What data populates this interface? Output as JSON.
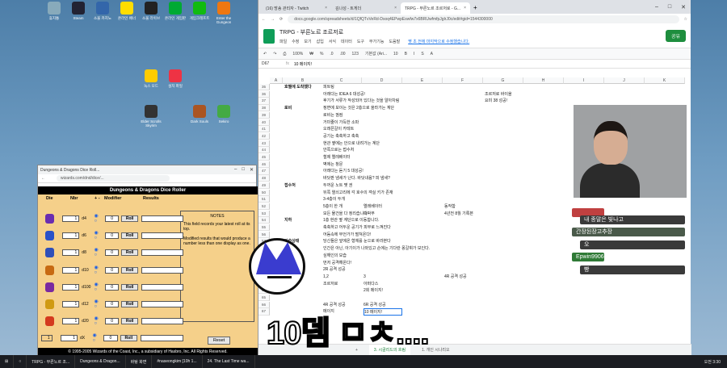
{
  "desktop": {
    "icons": [
      {
        "label": "휴지통"
      },
      {
        "label": "Steam"
      },
      {
        "label": "소울 카지노"
      },
      {
        "label": "온라인 배너"
      },
      {
        "label": "소울 라이브"
      },
      {
        "label": "온라인 게임판"
      },
      {
        "label": "게임크래프트"
      },
      {
        "label": "Enter the Gungeon"
      },
      {
        "label": "녹스 모드"
      },
      {
        "label": "설치 파일"
      },
      {
        "label": "Elder Scrolls Skyrim"
      },
      {
        "label": "Dark Souls"
      },
      {
        "label": "Sekiro"
      }
    ]
  },
  "dice": {
    "win_title": "Dungeons & Dragons Dice Roll...",
    "url": "wizards.com/dnd/dice/...",
    "header": "Dungeons & Dragons Dice Roller",
    "cols": {
      "die": "Die",
      "nbr": "Nbr",
      "pm": "+ -",
      "mod": "Modifier",
      "res": "Results"
    },
    "rows": [
      {
        "nbr": "1",
        "die": "d4",
        "mod": "0",
        "roll": "Roll"
      },
      {
        "nbr": "1",
        "die": "d6",
        "mod": "0",
        "roll": "Roll"
      },
      {
        "nbr": "1",
        "die": "d8",
        "mod": "0",
        "roll": "Roll"
      },
      {
        "nbr": "1",
        "die": "d10",
        "mod": "0",
        "roll": "Roll"
      },
      {
        "nbr": "1",
        "die": "d100",
        "mod": "0",
        "roll": "Roll"
      },
      {
        "nbr": "1",
        "die": "d12",
        "mod": "0",
        "roll": "Roll"
      },
      {
        "nbr": "1",
        "die": "d20",
        "mod": "0",
        "roll": "Roll"
      },
      {
        "nbr": "1",
        "die": "dX",
        "mod": "0",
        "roll": "Roll",
        "x": "1"
      }
    ],
    "notes_title": "NOTES",
    "notes_p1": "This field records your latest roll at its top.",
    "notes_p2": "Modified results that would produce a number less than one display as one.",
    "reset": "Reset",
    "copyright": "© 1995-2005 Wizards of the Coast, Inc., a subsidiary of Hasbro, Inc. All Rights Reserved."
  },
  "browser": {
    "tabs": [
      {
        "label": "(16) 방송 관리자 - Twitch"
      },
      {
        "label": "김나성 - 트게더"
      },
      {
        "label": "TRPG - 부른노르 조르저로 - G..."
      }
    ],
    "url": "docs.google.com/spreadsheets/d/1QfQTvVeRd-Dsoq4EPwpEswfw7x6BRUwfmfpJglrJ0c/edit#gid=1544300000"
  },
  "sheet": {
    "title": "TRPG - 부른노르 조르저로",
    "menus": [
      "파일",
      "수정",
      "보기",
      "삽입",
      "서식",
      "데이터",
      "도구",
      "부가기능",
      "도움말"
    ],
    "last_edit": "몇 초 전에 마지막으로 수정했습니다.",
    "share": "공유",
    "toolbar": [
      "100%",
      "₩",
      "%",
      ".0",
      ".00",
      "123",
      "기본값 (Ari...",
      "10",
      "B",
      "I",
      "S",
      "A"
    ],
    "cellref": "D67",
    "formula": "10 메이지!",
    "cols": [
      "A",
      "B",
      "C",
      "D",
      "E",
      "F",
      "G",
      "H",
      "I",
      "J",
      "K"
    ],
    "row_start": 35,
    "rows": [
      {
        "b": "호텔에 도착했다",
        "c": "피트팅"
      },
      {
        "c": "아래다는 IDEA 6 대성공!",
        "g": "조르저로 바이올"
      },
      {
        "c": "후기가 서류가 작성되어 있다는 것을 알아차림",
        "g": "요미 38 성공!"
      },
      {
        "b": "로비",
        "c": "정면에 보이는 것은 2층으로 올라가는 계단"
      },
      {
        "c": "로비는 껌컴"
      },
      {
        "c": "거미줄이 가득한 소파"
      },
      {
        "c": "오래픈갈이 카테트"
      },
      {
        "c": "공기는 축축하고 축축"
      },
      {
        "c": "현관 옆에는 안으로 내려가는 계단"
      },
      {
        "c": "안쪽으로는 접수처"
      },
      {
        "c": "철제 엘레베이터"
      },
      {
        "c": "벽에는 창문"
      },
      {
        "c": "아래다는 듣기 5 대성공!"
      },
      {
        "c": "바닷판 냄새가 난다. 바닷내음? 피 냄새?"
      },
      {
        "b": "접수처",
        "c": "두꺼운 노트 몇 권"
      },
      {
        "c": "뒤쪽 열쇠고리에 각 호수의 객실 키가 존재"
      },
      {
        "c": "3-4층이 두개"
      },
      {
        "c": "5층이 한 개",
        "d": "엘레베이터",
        "f": "동작함"
      },
      {
        "c": "모든 물건을 다 정리습니다.",
        "d": "속박부",
        "f": "4년전 8월 기록본"
      },
      {
        "b": "지하",
        "c": "1층 현관 옆 계단으로 이동합니다."
      },
      {
        "c": "축축하고 어두운 공기가 피부로 느껴진다"
      },
      {
        "c": "어둠속에 무언가가 떨쳐온다!"
      },
      {
        "b": "기습상태",
        "c": "당신들은 앞에온 형체를 눈으로 바라본다"
      },
      {
        "c": "인간은 아닌, 아기이가 나와있고 손에는 기다란 몽갈휘가 보인다."
      },
      {
        "c": "심해인의 모습"
      },
      {
        "c": "먼저 공격해온다!"
      },
      {
        "c": "2R 공격 성공"
      },
      {
        "c": "1,2",
        "d": "3",
        "f": "4R 공격 성공"
      },
      {
        "c": "조르저로",
        "d": "아퍼다스"
      },
      {
        "d": "2회 메이지!"
      },
      {
        "c": ""
      },
      {
        "c": "4R 공격 성공",
        "d": "6R 공격 성공"
      },
      {
        "c": "메이지",
        "d": "10 메이지!"
      }
    ],
    "sheettabs": [
      "3. 시골리드의 흐림",
      "1. 개인 시나리오"
    ]
  },
  "chat": [
    {
      "text": "내 종말은 빛나고",
      "color": "#3a3a3a"
    },
    {
      "text": "간장된장고추장",
      "color": "#4a5a4a"
    },
    {
      "text": "오",
      "color": "#3a3a3a"
    },
    {
      "text": "Epwin9906",
      "color": "#2f7a36"
    },
    {
      "text": "빵",
      "color": "#3a3a3a"
    }
  ],
  "caption": "10뎀 ㅁㅊ....",
  "taskbar": {
    "items": [
      "TRPG - 부른노르 조...",
      "Dungeons & Dragon...",
      "바탕 화면",
      "#naseongkim [10h 1...",
      "24. The Last Time wa..."
    ],
    "clock": "오전 3:30"
  }
}
